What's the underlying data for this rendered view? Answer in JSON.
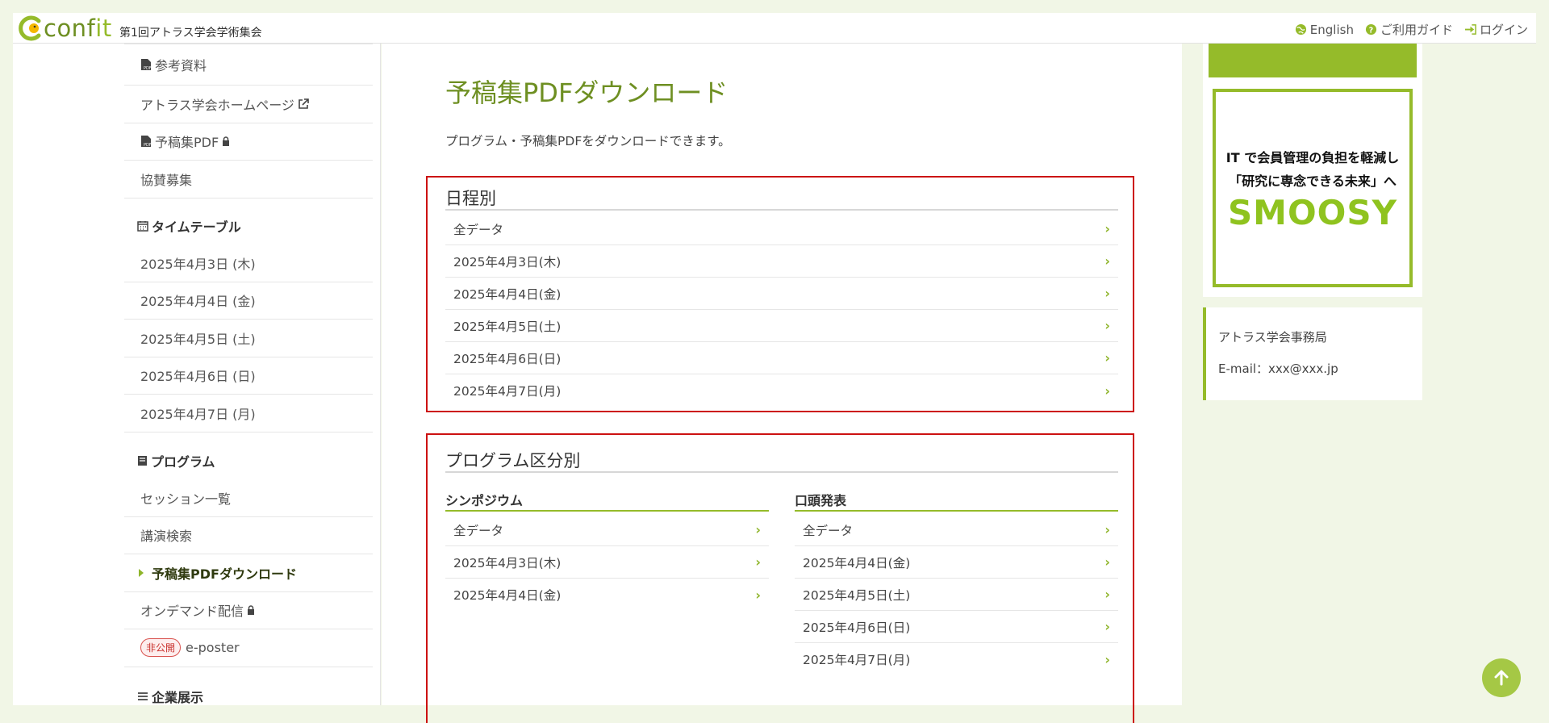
{
  "header": {
    "logo_text": "conf",
    "logo_text_it": "it",
    "event_title": "第1回アトラス学会学術集会",
    "links": [
      {
        "label": "English",
        "icon": "globe-icon"
      },
      {
        "label": "ご利用ガイド",
        "icon": "help-icon"
      },
      {
        "label": "ログイン",
        "icon": "login-icon"
      }
    ]
  },
  "sidebar": {
    "top_items": [
      {
        "label": "参考資料",
        "icon": "pdf-icon",
        "suffix": ""
      },
      {
        "label": "アトラス学会ホームページ",
        "icon": "",
        "suffix": "external-link-icon"
      },
      {
        "label": "予稿集PDF",
        "icon": "pdf-icon",
        "suffix": "lock-icon"
      },
      {
        "label": "協賛募集",
        "icon": "",
        "suffix": ""
      }
    ],
    "timetable": {
      "heading": "タイムテーブル",
      "items": [
        "2025年4月3日 (木)",
        "2025年4月4日 (金)",
        "2025年4月5日 (土)",
        "2025年4月6日 (日)",
        "2025年4月7日 (月)"
      ]
    },
    "program": {
      "heading": "プログラム",
      "items": [
        "セッション一覧",
        "講演検索",
        "予稿集PDFダウンロード",
        "オンデマンド配信",
        "e-poster"
      ],
      "badge": "非公開"
    },
    "exhibit_heading": "企業展示"
  },
  "main": {
    "title": "予稿集PDFダウンロード",
    "intro": "プログラム・予稿集PDFをダウンロードできます。",
    "by_date": {
      "title": "日程別",
      "rows": [
        "全データ",
        "2025年4月3日(木)",
        "2025年4月4日(金)",
        "2025年4月5日(土)",
        "2025年4月6日(日)",
        "2025年4月7日(月)"
      ]
    },
    "by_program": {
      "title": "プログラム区分別",
      "symposium": {
        "title": "シンポジウム",
        "rows": [
          "全データ",
          "2025年4月3日(木)",
          "2025年4月4日(金)"
        ]
      },
      "oral": {
        "title": "口頭発表",
        "rows": [
          "全データ",
          "2025年4月4日(金)",
          "2025年4月5日(土)",
          "2025年4月6日(日)",
          "2025年4月7日(月)"
        ]
      }
    }
  },
  "ad": {
    "line1": "IT で会員管理の負担を軽減し",
    "line2": "「研究に専念できる未来」へ",
    "brand": "SMOOSY"
  },
  "contact": {
    "org": "アトラス学会事務局",
    "email": "E-mail：xxx@xxx.jp"
  },
  "colors": {
    "accent": "#95bb2a",
    "title_green": "#6e8f22",
    "highlight_red": "#cc1111"
  }
}
